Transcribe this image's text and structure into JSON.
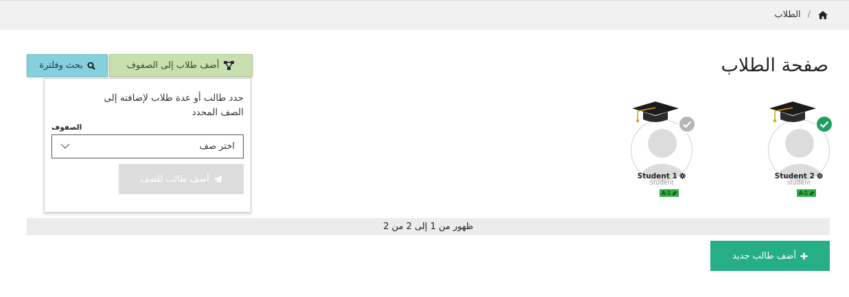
{
  "breadcrumb": {
    "current": "الطلاب",
    "separator": "/"
  },
  "page": {
    "title": "صفحة الطلاب"
  },
  "toolbar": {
    "search_label": "بحث وفلترة",
    "add_to_class_label": "أضف طلاب إلى الصفوف"
  },
  "add_panel": {
    "instructions": "حدد طالب أو عدة طلاب لإضافته إلى الصف المحدد",
    "class_label": "الصفوف",
    "class_select_value": "اختر صف",
    "submit_label": "أضف طالب للصف"
  },
  "students": [
    {
      "name": "Student 2",
      "role": "student",
      "class": "A-1",
      "selected": true
    },
    {
      "name": "Student 1",
      "role": "Student",
      "class": "A-1",
      "selected": false
    }
  ],
  "pagination": {
    "summary": "ظهور من 1 إلى 2 من 2"
  },
  "actions": {
    "new_student_label": "أضف طالب جديد"
  },
  "colors": {
    "search_button": "#86cfdc",
    "add_class_button": "#c9dfb0",
    "new_student_button": "#26ae86",
    "selected_check": "#1fa05e",
    "unselected_check": "#b5b5b5",
    "class_badge": "#2eac3f"
  },
  "icons": {
    "home": "home-icon",
    "search": "search-icon",
    "add_class": "sitemap-icon",
    "submit": "paper-plane-icon",
    "new_student": "plus-icon",
    "settings": "gear-icon",
    "badge": "link-icon",
    "select": "chevron-down-icon"
  }
}
